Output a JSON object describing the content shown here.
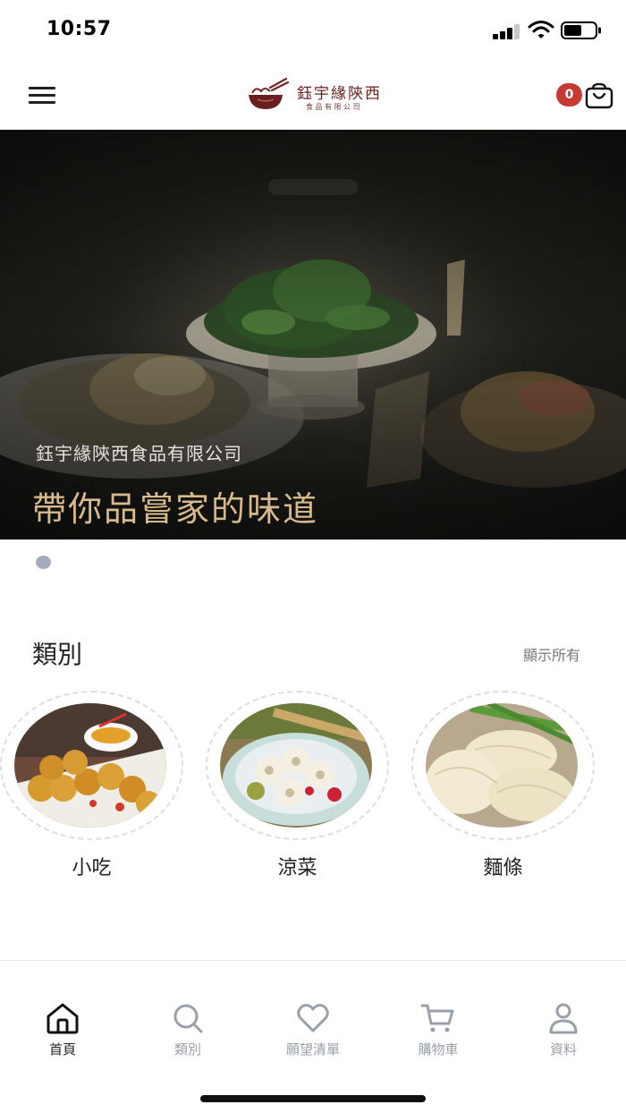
{
  "status_bar": {
    "time": "10:57"
  },
  "header": {
    "brand_name": "鈺宇緣陝西",
    "brand_sub": "食品有限公司",
    "cart_count": "0"
  },
  "hero": {
    "subtitle": "鈺宇緣陝西食品有限公司",
    "title": "帶你品嘗家的味道"
  },
  "categories": {
    "title": "類別",
    "show_all": "顯示所有",
    "items": [
      {
        "label": "小吃"
      },
      {
        "label": "涼菜"
      },
      {
        "label": "麵條"
      }
    ]
  },
  "bottom_nav": {
    "items": [
      {
        "label": "首頁",
        "icon": "home-icon",
        "active": true
      },
      {
        "label": "類別",
        "icon": "search-icon",
        "active": false
      },
      {
        "label": "願望清單",
        "icon": "heart-icon",
        "active": false
      },
      {
        "label": "購物車",
        "icon": "cart-icon",
        "active": false
      },
      {
        "label": "資料",
        "icon": "user-icon",
        "active": false
      }
    ]
  },
  "colors": {
    "accent_red": "#c73a34",
    "brand_dark_red": "#6b1e1e",
    "hero_title_gold": "#d8b98c",
    "nav_inactive": "#9aa0aa"
  }
}
